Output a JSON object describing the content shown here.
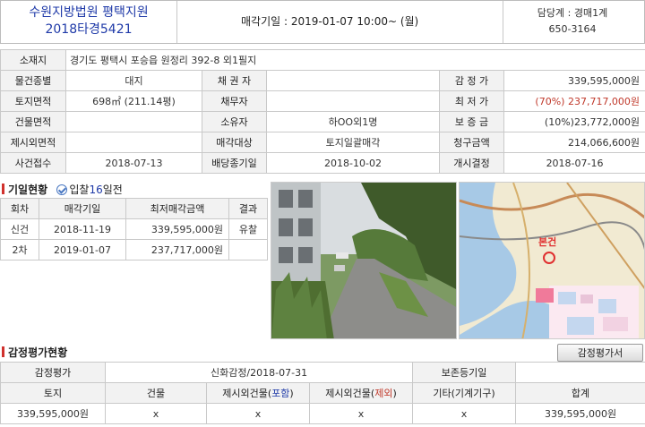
{
  "header": {
    "court_line1": "수원지방법원 평택지원",
    "court_line2": "2018타경5421",
    "auction_datetime": "매각기일 : 2019-01-07 10:00~ (월)",
    "dept": "담당계 : 경매1계",
    "phone": "650-3164"
  },
  "summary": {
    "location_label": "소재지",
    "location_value": "경기도 평택시 포승읍 원정리 392-8 외1필지",
    "rows": [
      [
        "물건종별",
        "대지",
        "채 권 자",
        "",
        "감 정 가",
        "339,595,000원"
      ],
      [
        "토지면적",
        "698㎡ (211.14평)",
        "채무자",
        "",
        "최 저 가",
        "(70%) 237,717,000원"
      ],
      [
        "건물면적",
        "",
        "소유자",
        "하OO외1명",
        "보 증 금",
        "(10%)23,772,000원"
      ],
      [
        "제시외면적",
        "",
        "매각대상",
        "토지일괄매각",
        "청구금액",
        "214,066,600원"
      ],
      [
        "사건접수",
        "2018-07-13",
        "배당종기일",
        "2018-10-02",
        "개시결정",
        "2018-07-16"
      ]
    ]
  },
  "history": {
    "title": "기일현황",
    "bid_prefix": "입찰",
    "bid_days": "16",
    "bid_suffix": "일전",
    "columns": [
      "회차",
      "매각기일",
      "최저매각금액",
      "결과"
    ],
    "rows": [
      [
        "신건",
        "2018-11-19",
        "339,595,000원",
        "유찰"
      ],
      [
        "2차",
        "2019-01-07",
        "237,717,000원",
        ""
      ]
    ]
  },
  "map": {
    "label": "본건"
  },
  "appraisal": {
    "title": "감정평가현황",
    "button_label": "감정평가서",
    "label": "감정평가",
    "appraiser": "신화감정/2018-07-31",
    "base_date_label": "보존등기일",
    "base_date_value": "",
    "columns": [
      "토지",
      "건물",
      "제시외건물(포함)",
      "제시외건물(제외)",
      "기타(기계기구)",
      "합계"
    ],
    "col3_prefix": "제시외건물(",
    "col3_mid": "포함",
    "col4_mid": "제외",
    "values": [
      "339,595,000원",
      "x",
      "x",
      "x",
      "x",
      "339,595,000원"
    ]
  },
  "colors": {
    "court_blue": "#1f3aa8",
    "accent_red": "#c0392b",
    "label_bg": "#f2f2f2"
  }
}
